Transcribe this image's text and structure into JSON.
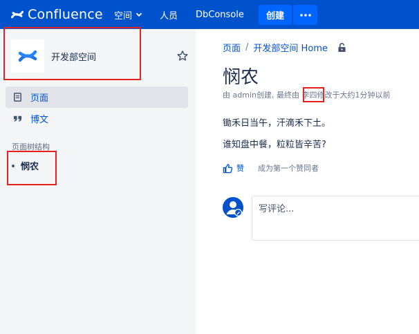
{
  "topbar": {
    "brand": "Confluence",
    "spaces_label": "空间",
    "people_label": "人员",
    "dbconsole_label": "DbConsole",
    "create_label": "创建",
    "colors": {
      "bar": "#0052cc",
      "button": "#0065ff"
    }
  },
  "sidebar": {
    "space_name": "开发部空间",
    "items": [
      {
        "label": "页面",
        "icon": "page-icon",
        "active": true
      },
      {
        "label": "博文",
        "icon": "quote-icon",
        "active": false
      }
    ],
    "tree_title": "页面树结构",
    "tree_items": [
      {
        "label": "悯农"
      }
    ]
  },
  "main": {
    "breadcrumb": {
      "root": "页面",
      "sep": "/",
      "home": "开发部空间 Home"
    },
    "title": "悯农",
    "byline": {
      "prefix": "由 ",
      "author": "admin",
      "created": "创建, 最终由 ",
      "editor": "李四",
      "modified": "修改于",
      "time": "大约1分钟以前"
    },
    "content": [
      "锄禾日当午，汗滴禾下土。",
      "谁知盘中餐，粒粒皆辛苦?"
    ],
    "like": {
      "label": "赞",
      "first_text": "成为第一个赞同者"
    },
    "comment": {
      "placeholder": "写评论..."
    }
  },
  "annotation_color": "#e81f1f"
}
